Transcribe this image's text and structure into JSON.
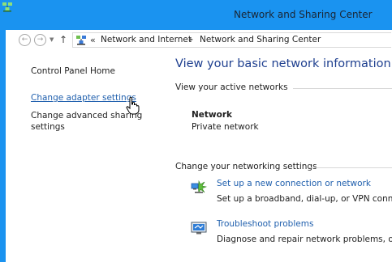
{
  "window": {
    "title": "Network and Sharing Center",
    "accent_color": "#1a93f0"
  },
  "addressbar": {
    "back_icon": "back-arrow-icon",
    "forward_icon": "forward-arrow-icon",
    "recent_icon": "chevron-down-icon",
    "up_icon": "up-arrow-icon",
    "overflow": "«",
    "breadcrumbs": [
      {
        "label": "Network and Internet"
      },
      {
        "label": "Network and Sharing Center"
      }
    ],
    "separator": "▸"
  },
  "sidebar": {
    "home": "Control Panel Home",
    "tasks": [
      {
        "label": "Change adapter settings"
      },
      {
        "label": "Change advanced sharing settings"
      }
    ]
  },
  "main": {
    "title": "View your basic network information and",
    "active_networks_label": "View your active networks",
    "network": {
      "name": "Network",
      "type": "Private network"
    },
    "settings_label": "Change your networking settings",
    "tasks": [
      {
        "icon": "network-connection-icon",
        "link": "Set up a new connection or network",
        "description": "Set up a broadband, dial-up, or VPN connec"
      },
      {
        "icon": "troubleshoot-icon",
        "link": "Troubleshoot problems",
        "description": "Diagnose and repair network problems, or g"
      }
    ]
  }
}
